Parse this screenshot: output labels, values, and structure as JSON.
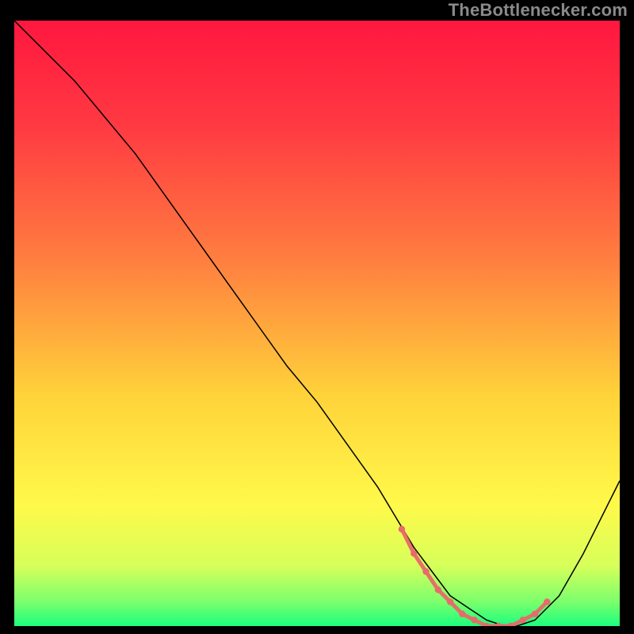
{
  "watermark": "TheBottlenecker.com",
  "chart_data": {
    "type": "line",
    "xlim": [
      0,
      100
    ],
    "ylim": [
      0,
      100
    ],
    "title": "",
    "xlabel": "",
    "ylabel": "",
    "background_gradient": {
      "stops": [
        {
          "offset": 0,
          "color": "#ff173f"
        },
        {
          "offset": 18,
          "color": "#ff3b42"
        },
        {
          "offset": 40,
          "color": "#ff8040"
        },
        {
          "offset": 62,
          "color": "#ffd33a"
        },
        {
          "offset": 80,
          "color": "#fff94a"
        },
        {
          "offset": 90,
          "color": "#d7ff5a"
        },
        {
          "offset": 96,
          "color": "#7bff6c"
        },
        {
          "offset": 100,
          "color": "#1bff7e"
        }
      ]
    },
    "series": [
      {
        "name": "bottleneck-curve",
        "color": "#000000",
        "stroke_width": 1.5,
        "x": [
          0,
          5,
          10,
          15,
          20,
          25,
          30,
          35,
          40,
          45,
          50,
          55,
          60,
          63,
          66,
          69,
          72,
          75,
          78,
          81,
          83,
          86,
          90,
          94,
          98,
          100
        ],
        "y": [
          100,
          95,
          90,
          84,
          78,
          71,
          64,
          57,
          50,
          43,
          37,
          30,
          23,
          18,
          13,
          9,
          5,
          3,
          1,
          0,
          0,
          1,
          5,
          12,
          20,
          24
        ]
      },
      {
        "name": "optimal-zone-markers",
        "color": "#e86a6a",
        "stroke_width": 5,
        "marker_radius": 3.2,
        "x": [
          64,
          66,
          68,
          70,
          72,
          74,
          76,
          78,
          80,
          82,
          84,
          86,
          88
        ],
        "y": [
          16,
          12,
          9,
          6,
          4,
          2,
          1,
          0,
          0,
          0,
          1,
          2,
          4
        ]
      }
    ]
  }
}
